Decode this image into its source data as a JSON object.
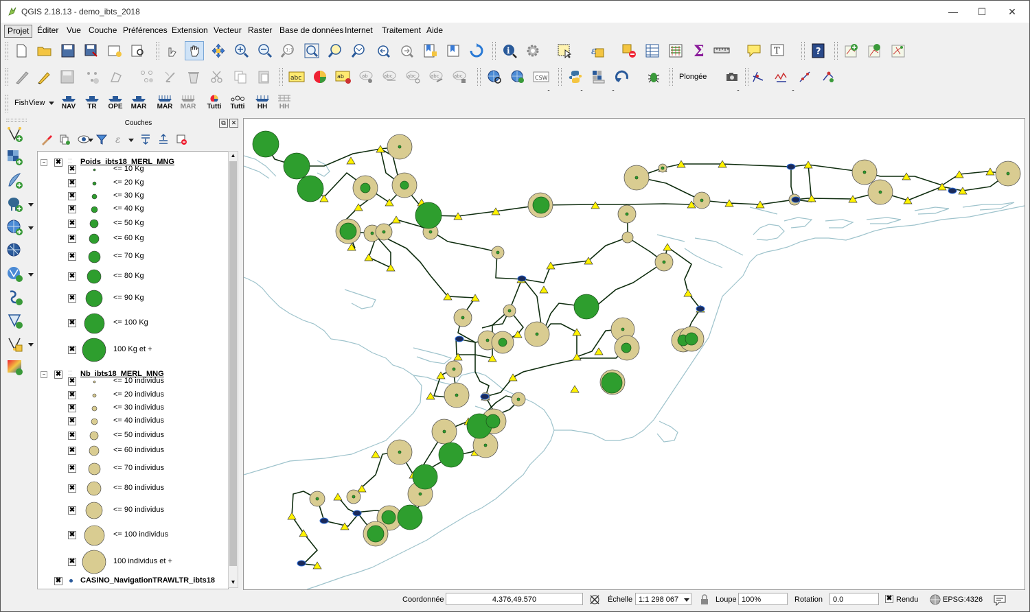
{
  "window": {
    "title": "QGIS 2.18.13 - demo_ibts_2018",
    "buttons": [
      "—",
      "☐",
      "✕"
    ]
  },
  "menubar": {
    "items": [
      "Projet",
      "Éditer",
      "Vue",
      "Couche",
      "Préférences",
      "Extension",
      "Vecteur",
      "Raster",
      "Base de données",
      "Internet",
      "Traitement",
      "Aide"
    ]
  },
  "toolbar3": {
    "fishview_label": "FishView",
    "buttons": [
      "NAV",
      "TR",
      "OPE",
      "MAR",
      "MAR",
      "MAR",
      "Tutti",
      "Tutti",
      "HH",
      "HH"
    ]
  },
  "toolbar2": {
    "zoom_combo": "Plongée",
    "csw_label": "CSW"
  },
  "layers_panel": {
    "title": "Couches",
    "groups": [
      {
        "name": "Poids_ibts18_MERL_MNG",
        "color": "#2e9e2e",
        "classes": [
          "<= 10 Kg",
          "<= 20 Kg",
          "<= 30 Kg",
          "<= 40 Kg",
          "<= 50 Kg",
          "<= 60 Kg",
          "<= 70 Kg",
          "<= 80 Kg",
          "<= 90 Kg",
          "<= 100 Kg",
          "100 Kg et +"
        ]
      },
      {
        "name": "Nb_ibts18_MERL_MNG",
        "color": "#d9cc91",
        "classes": [
          "<= 10 individus",
          "<= 20 individus",
          "<= 30 individus",
          "<= 40 individus",
          "<= 50 individus",
          "<= 60 individus",
          "<= 70 individus",
          "<= 80 individus",
          "<= 90 individus",
          "<= 100 individus",
          "100 individus et +"
        ]
      }
    ],
    "last_layer": "CASINO_NavigationTRAWLTR_ibts18"
  },
  "statusbar": {
    "coord_label": "Coordonnée",
    "coord_value": "4.376,49.570",
    "scale_label": "Échelle",
    "scale_value": "1:1 298 067",
    "magnifier_label": "Loupe",
    "magnifier_value": "100%",
    "rotation_label": "Rotation",
    "rotation_value": "0.0",
    "render_label": "Rendu",
    "crs_label": "EPSG:4326"
  },
  "map": {
    "coast_color": "#9ec3cc",
    "track_color": "#0f2d0f",
    "weight_color": "#2e9e2e",
    "count_color": "#d9cc91",
    "station_color": "#fff200"
  }
}
